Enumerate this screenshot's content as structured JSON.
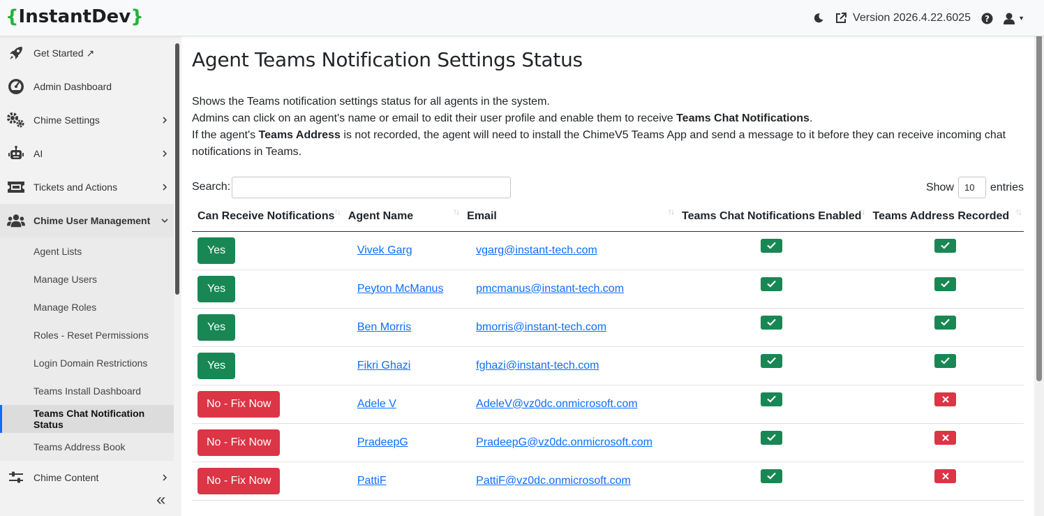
{
  "app": {
    "logo_open": "{",
    "logo_text": "InstantDev",
    "logo_close": "}",
    "version": "Version 2026.4.22.6025"
  },
  "sidebar": {
    "items": [
      {
        "label": "Get Started ↗",
        "icon": "rocket-icon"
      },
      {
        "label": "Admin Dashboard",
        "icon": "gauge-icon"
      },
      {
        "label": "Chime Settings",
        "icon": "gears-icon"
      },
      {
        "label": "AI",
        "icon": "robot-icon"
      },
      {
        "label": "Tickets and Actions",
        "icon": "ticket-icon"
      },
      {
        "label": "Chime User Management",
        "icon": "users-icon"
      },
      {
        "label": "Chime Content",
        "icon": "sliders-icon"
      }
    ],
    "sub_items": [
      "Agent Lists",
      "Manage Users",
      "Manage Roles",
      "Roles - Reset Permissions",
      "Login Domain Restrictions",
      "Teams Install Dashboard",
      "Teams Chat Notification Status",
      "Teams Address Book"
    ],
    "active_sub": "Teams Chat Notification Status",
    "collapse_glyph": "«"
  },
  "page": {
    "title": "Agent Teams Notification Settings Status",
    "desc_line1": "Shows the Teams notification settings status for all agents in the system.",
    "desc_line2_pre": "Admins can click on an agent's name or email to edit their user profile and enable them to receive ",
    "desc_line2_bold": "Teams Chat Notifications",
    "desc_line2_post": ".",
    "desc_line3_pre": "If the agent's ",
    "desc_line3_bold": "Teams Address",
    "desc_line3_post": " is not recorded, the agent will need to install the ChimeV5 Teams App and send a message to it before they can receive incoming chat notifications in Teams."
  },
  "table_controls": {
    "search_label": "Search:",
    "search_value": "",
    "show_label": "Show",
    "show_value": "10",
    "entries_label": "entries"
  },
  "table": {
    "columns": [
      "Can Receive Notifications",
      "Agent Name",
      "Email",
      "Teams Chat Notifications Enabled",
      "Teams Address Recorded"
    ],
    "rows": [
      {
        "status": "Yes",
        "ok": true,
        "name": "Vivek Garg",
        "email": "vgarg@instant-tech.com",
        "chat_enabled": true,
        "address_recorded": true
      },
      {
        "status": "Yes",
        "ok": true,
        "name": "Peyton McManus",
        "email": "pmcmanus@instant-tech.com",
        "chat_enabled": true,
        "address_recorded": true
      },
      {
        "status": "Yes",
        "ok": true,
        "name": "Ben Morris",
        "email": "bmorris@instant-tech.com",
        "chat_enabled": true,
        "address_recorded": true
      },
      {
        "status": "Yes",
        "ok": true,
        "name": "Fikri Ghazi",
        "email": "fghazi@instant-tech.com",
        "chat_enabled": true,
        "address_recorded": true
      },
      {
        "status": "No - Fix Now",
        "ok": false,
        "name": "Adele V",
        "email": "AdeleV@vz0dc.onmicrosoft.com",
        "chat_enabled": true,
        "address_recorded": false
      },
      {
        "status": "No - Fix Now",
        "ok": false,
        "name": "PradeepG",
        "email": "PradeepG@vz0dc.onmicrosoft.com",
        "chat_enabled": true,
        "address_recorded": false
      },
      {
        "status": "No - Fix Now",
        "ok": false,
        "name": "PattiF",
        "email": "PattiF@vz0dc.onmicrosoft.com",
        "chat_enabled": true,
        "address_recorded": false
      }
    ]
  },
  "colors": {
    "success": "#198754",
    "danger": "#dc3545",
    "link": "#0d6efd",
    "logo_brace": "#22b33a"
  }
}
